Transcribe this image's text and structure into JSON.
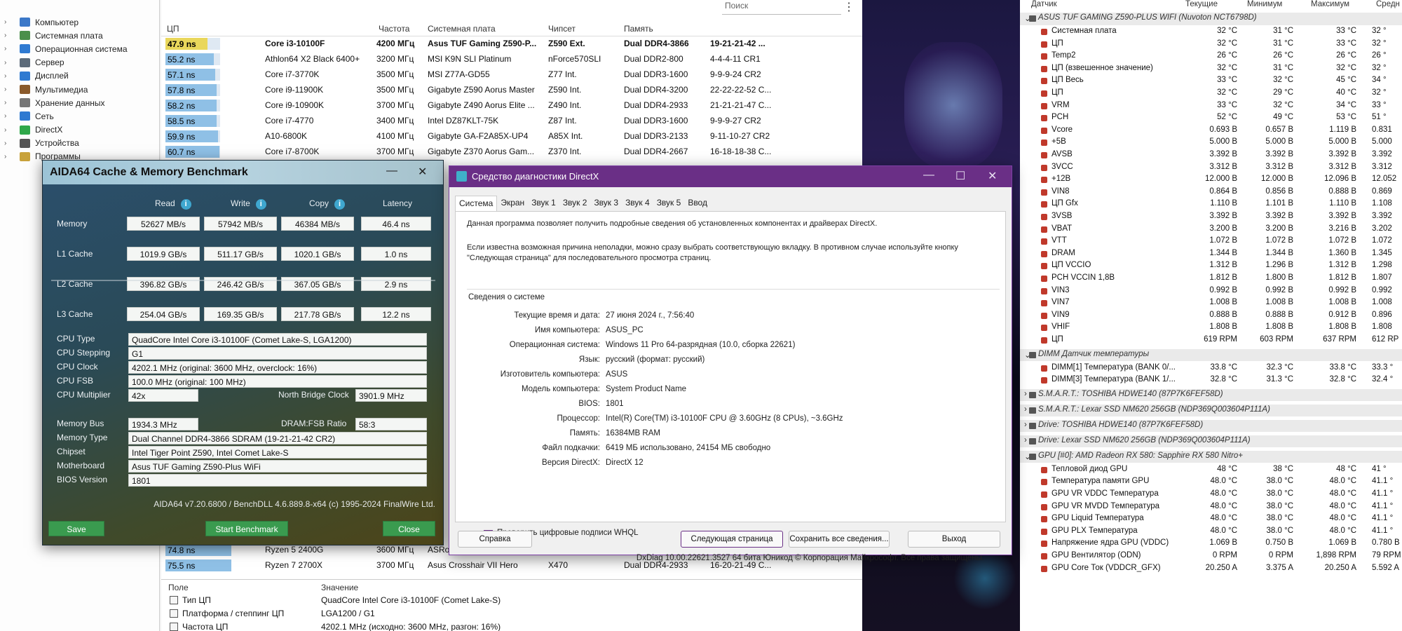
{
  "aida_main": {
    "search_placeholder": "Поиск",
    "sidebar": [
      {
        "label": "Компьютер",
        "color": "#3b78c8"
      },
      {
        "label": "Системная плата",
        "color": "#4a8f4a"
      },
      {
        "label": "Операционная система",
        "color": "#2f7ad1"
      },
      {
        "label": "Сервер",
        "color": "#5c6b7a"
      },
      {
        "label": "Дисплей",
        "color": "#2f7ad1"
      },
      {
        "label": "Мультимедиа",
        "color": "#8a5a2b"
      },
      {
        "label": "Хранение данных",
        "color": "#777777"
      },
      {
        "label": "Сеть",
        "color": "#2f7ad1"
      },
      {
        "label": "DirectX",
        "color": "#2fa84a"
      },
      {
        "label": "Устройства",
        "color": "#555555"
      },
      {
        "label": "Программы",
        "color": "#c8a23b"
      }
    ],
    "columns": [
      "ЦП",
      "Частота",
      "Системная плата",
      "Чипсет",
      "Память",
      ""
    ],
    "rows": [
      {
        "score": "47.9 ns",
        "fill": 0.32,
        "cpu": "Core i3-10100F",
        "freq": "4200 МГц",
        "board": "Asus TUF Gaming Z590-P...",
        "chipset": "Z590 Ext.",
        "memory": "Dual DDR4-3866",
        "timing": "19-21-21-42 ...",
        "highlight": true
      },
      {
        "score": "55.2 ns",
        "fill": 0.37,
        "cpu": "Athlon64 X2 Black 6400+",
        "freq": "3200 МГц",
        "board": "MSI K9N SLI Platinum",
        "chipset": "nForce570SLI",
        "memory": "Dual DDR2-800",
        "timing": "4-4-4-11 CR1",
        "highlight": false
      },
      {
        "score": "57.1 ns",
        "fill": 0.38,
        "cpu": "Core i7-3770K",
        "freq": "3500 МГц",
        "board": "MSI Z77A-GD55",
        "chipset": "Z77 Int.",
        "memory": "Dual DDR3-1600",
        "timing": "9-9-9-24 CR2",
        "highlight": false
      },
      {
        "score": "57.8 ns",
        "fill": 0.39,
        "cpu": "Core i9-11900K",
        "freq": "3500 МГц",
        "board": "Gigabyte Z590 Aorus Master",
        "chipset": "Z590 Int.",
        "memory": "Dual DDR4-3200",
        "timing": "22-22-22-52 C...",
        "highlight": false
      },
      {
        "score": "58.2 ns",
        "fill": 0.39,
        "cpu": "Core i9-10900K",
        "freq": "3700 МГц",
        "board": "Gigabyte Z490 Aorus Elite ...",
        "chipset": "Z490 Int.",
        "memory": "Dual DDR4-2933",
        "timing": "21-21-21-47 C...",
        "highlight": false
      },
      {
        "score": "58.5 ns",
        "fill": 0.39,
        "cpu": "Core i7-4770",
        "freq": "3400 МГц",
        "board": "Intel DZ87KLT-75K",
        "chipset": "Z87 Int.",
        "memory": "Dual DDR3-1600",
        "timing": "9-9-9-27 CR2",
        "highlight": false
      },
      {
        "score": "59.9 ns",
        "fill": 0.4,
        "cpu": "A10-6800K",
        "freq": "4100 МГц",
        "board": "Gigabyte GA-F2A85X-UP4",
        "chipset": "A85X Int.",
        "memory": "Dual DDR3-2133",
        "timing": "9-11-10-27 CR2",
        "highlight": false
      },
      {
        "score": "60.7 ns",
        "fill": 0.41,
        "cpu": "Core i7-8700K",
        "freq": "3700 МГц",
        "board": "Gigabyte Z370 Aorus Gam...",
        "chipset": "Z370 Int.",
        "memory": "Dual DDR4-2667",
        "timing": "16-18-18-38 C...",
        "highlight": false
      }
    ],
    "rows_lower": [
      {
        "score": "74.8 ns",
        "fill": 0.5,
        "cpu": "Ryzen 5 2400G",
        "freq": "3600 МГц",
        "board": "ASRo...",
        "chipset": "",
        "memory": "",
        "timing": ""
      },
      {
        "score": "75.5 ns",
        "fill": 0.5,
        "cpu": "Ryzen 7 2700X",
        "freq": "3700 МГц",
        "board": "Asus Crosshair VII Hero",
        "chipset": "X470",
        "memory": "Dual DDR4-2933",
        "timing": "16-20-21-49 C..."
      }
    ],
    "bottom": {
      "col_field": "Поле",
      "col_value": "Значение",
      "rows": [
        {
          "field": "Тип ЦП",
          "value": "QuadCore Intel Core i3-10100F  (Comet Lake-S)"
        },
        {
          "field": "Платформа / степпинг ЦП",
          "value": "LGA1200 / G1"
        },
        {
          "field": "Частота ЦП",
          "value": "4202.1 MHz  (исходно: 3600 MHz, разгон: 16%)"
        }
      ]
    }
  },
  "bench": {
    "title": "AIDA64 Cache & Memory Benchmark",
    "headers": {
      "read": "Read",
      "write": "Write",
      "copy": "Copy",
      "latency": "Latency"
    },
    "rows": [
      {
        "label": "Memory",
        "read": "52627 MB/s",
        "write": "57942 MB/s",
        "copy": "46384 MB/s",
        "latency": "46.4 ns"
      },
      {
        "label": "L1 Cache",
        "read": "1019.9 GB/s",
        "write": "511.17 GB/s",
        "copy": "1020.1 GB/s",
        "latency": "1.0 ns"
      },
      {
        "label": "L2 Cache",
        "read": "396.82 GB/s",
        "write": "246.42 GB/s",
        "copy": "367.05 GB/s",
        "latency": "2.9 ns"
      },
      {
        "label": "L3 Cache",
        "read": "254.04 GB/s",
        "write": "169.35 GB/s",
        "copy": "217.78 GB/s",
        "latency": "12.2 ns"
      }
    ],
    "cpu": {
      "type_label": "CPU Type",
      "type": "QuadCore Intel Core i3-10100F  (Comet Lake-S, LGA1200)",
      "stepping_label": "CPU Stepping",
      "stepping": "G1",
      "clock_label": "CPU Clock",
      "clock": "4202.1 MHz  (original: 3600 MHz, overclock: 16%)",
      "fsb_label": "CPU FSB",
      "fsb": "100.0 MHz  (original: 100 MHz)",
      "mult_label": "CPU Multiplier",
      "mult": "42x",
      "nb_label": "North Bridge Clock",
      "nb": "3901.9 MHz"
    },
    "mem": {
      "bus_label": "Memory Bus",
      "bus": "1934.3 MHz",
      "ratio_label": "DRAM:FSB Ratio",
      "ratio": "58:3",
      "type_label": "Memory Type",
      "type": "Dual Channel DDR4-3866 SDRAM  (19-21-21-42 CR2)",
      "chipset_label": "Chipset",
      "chipset": "Intel Tiger Point Z590, Intel Comet Lake-S",
      "mb_label": "Motherboard",
      "mb": "Asus TUF Gaming Z590-Plus WiFi",
      "bios_label": "BIOS Version",
      "bios": "1801"
    },
    "footer": "AIDA64 v7.20.6800 / BenchDLL 4.6.889.8-x64  (c) 1995-2024 FinalWire Ltd.",
    "buttons": {
      "save": "Save",
      "start": "Start Benchmark",
      "close": "Close"
    }
  },
  "dx": {
    "title": "Средство диагностики DirectX",
    "tabs": [
      "Система",
      "Экран",
      "Звук 1",
      "Звук 2",
      "Звук 3",
      "Звук 4",
      "Звук 5",
      "Ввод"
    ],
    "intro": "Данная программа позволяет получить подробные сведения об установленных компонентах и драйверах DirectX.",
    "hint": "Если известна возможная причина неполадки, можно сразу выбрать соответствующую вкладку. В противном случае используйте кнопку \"Следующая страница\" для последовательного просмотра страниц.",
    "section": "Сведения о системе",
    "info": [
      {
        "k": "Текущие время и дата:",
        "v": "27 июня 2024 г., 7:56:40"
      },
      {
        "k": "Имя компьютера:",
        "v": "ASUS_PC"
      },
      {
        "k": "Операционная система:",
        "v": "Windows 11 Pro 64-разрядная (10.0, сборка 22621)"
      },
      {
        "k": "Язык:",
        "v": "русский (формат: русский)"
      },
      {
        "k": "Изготовитель компьютера:",
        "v": "ASUS"
      },
      {
        "k": "Модель компьютера:",
        "v": "System Product Name"
      },
      {
        "k": "BIOS:",
        "v": "1801"
      },
      {
        "k": "Процессор:",
        "v": "Intel(R) Core(TM) i3-10100F CPU @ 3.60GHz (8 CPUs), ~3.6GHz"
      },
      {
        "k": "Память:",
        "v": "16384MB RAM"
      },
      {
        "k": "Файл подкачки:",
        "v": "6419 МБ использовано, 24154 МБ свободно"
      },
      {
        "k": "Версия DirectX:",
        "v": "DirectX 12"
      }
    ],
    "whql": "Проверить цифровые подписи WHQL",
    "footer": "DxDiag 10.00.22621.3527 64 бита Юникод © Корпорация Майкрософт. Все права защищены.",
    "buttons": {
      "help": "Справка",
      "next": "Следующая страница",
      "save": "Сохранить все сведения...",
      "exit": "Выход"
    }
  },
  "hw": {
    "headers": {
      "sensor": "Датчик",
      "current": "Текущие",
      "min": "Минимум",
      "max": "Максимум",
      "avg": "Средн"
    },
    "groups": [
      {
        "name": "ASUS TUF GAMING Z590-PLUS WIFI (Nuvoton NCT6798D)",
        "rows": [
          [
            "Системная плата",
            "32 °C",
            "31 °C",
            "33 °C",
            "32 °"
          ],
          [
            "ЦП",
            "32 °C",
            "31 °C",
            "33 °C",
            "32 °"
          ],
          [
            "Temp2",
            "26 °C",
            "26 °C",
            "26 °C",
            "26 °"
          ],
          [
            "ЦП (взвешенное значение)",
            "32 °C",
            "31 °C",
            "32 °C",
            "32 °"
          ],
          [
            "ЦП Весь",
            "33 °C",
            "32 °C",
            "45 °C",
            "34 °"
          ],
          [
            "ЦП",
            "32 °C",
            "29 °C",
            "40 °C",
            "32 °"
          ],
          [
            "VRM",
            "33 °C",
            "32 °C",
            "34 °C",
            "33 °"
          ],
          [
            "PCH",
            "52 °C",
            "49 °C",
            "53 °C",
            "51 °"
          ],
          [
            "Vcore",
            "0.693 В",
            "0.657 В",
            "1.119 В",
            "0.831"
          ],
          [
            "+5В",
            "5.000 В",
            "5.000 В",
            "5.000 В",
            "5.000"
          ],
          [
            "AVSB",
            "3.392 В",
            "3.392 В",
            "3.392 В",
            "3.392"
          ],
          [
            "3VCC",
            "3.312 В",
            "3.312 В",
            "3.312 В",
            "3.312"
          ],
          [
            "+12В",
            "12.000 В",
            "12.000 В",
            "12.096 В",
            "12.052"
          ],
          [
            "VIN8",
            "0.864 В",
            "0.856 В",
            "0.888 В",
            "0.869"
          ],
          [
            "ЦП Gfx",
            "1.110 В",
            "1.101 В",
            "1.110 В",
            "1.108"
          ],
          [
            "3VSB",
            "3.392 В",
            "3.392 В",
            "3.392 В",
            "3.392"
          ],
          [
            "VBAT",
            "3.200 В",
            "3.200 В",
            "3.216 В",
            "3.202"
          ],
          [
            "VTT",
            "1.072 В",
            "1.072 В",
            "1.072 В",
            "1.072"
          ],
          [
            "DRAM",
            "1.344 В",
            "1.344 В",
            "1.360 В",
            "1.345"
          ],
          [
            "ЦП VCCIO",
            "1.312 В",
            "1.296 В",
            "1.312 В",
            "1.298"
          ],
          [
            "PCH VCCIN 1,8В",
            "1.812 В",
            "1.800 В",
            "1.812 В",
            "1.807"
          ],
          [
            "VIN3",
            "0.992 В",
            "0.992 В",
            "0.992 В",
            "0.992"
          ],
          [
            "VIN7",
            "1.008 В",
            "1.008 В",
            "1.008 В",
            "1.008"
          ],
          [
            "VIN9",
            "0.888 В",
            "0.888 В",
            "0.912 В",
            "0.896"
          ],
          [
            "VHIF",
            "1.808 В",
            "1.808 В",
            "1.808 В",
            "1.808"
          ],
          [
            "ЦП",
            "619 RPM",
            "603 RPM",
            "637 RPM",
            "612 RP"
          ]
        ]
      },
      {
        "name": "DIMM Датчик температуры",
        "rows": [
          [
            "DIMM[1] Температура (BANK 0/...",
            "33.8 °C",
            "32.3 °C",
            "33.8 °C",
            "33.3 °"
          ],
          [
            "DIMM[3] Температура (BANK 1/...",
            "32.8 °C",
            "31.3 °C",
            "32.8 °C",
            "32.4 °"
          ]
        ]
      },
      {
        "name": "S.M.A.R.T.: TOSHIBA HDWE140 (87P7K6FEF58D)",
        "rows": []
      },
      {
        "name": "S.M.A.R.T.: Lexar SSD NM620 256GB (NDP369Q003604P111A)",
        "rows": []
      },
      {
        "name": "Drive: TOSHIBA HDWE140 (87P7K6FEF58D)",
        "rows": []
      },
      {
        "name": "Drive: Lexar SSD NM620 256GB (NDP369Q003604P111A)",
        "rows": []
      },
      {
        "name": "GPU [#0]: AMD Radeon RX 580: Sapphire RX 580 Nitro+",
        "rows": [
          [
            "Тепловой диод GPU",
            "48 °C",
            "38 °C",
            "48 °C",
            "41 °"
          ],
          [
            "Температура памяти GPU",
            "48.0 °C",
            "38.0 °C",
            "48.0 °C",
            "41.1 °"
          ],
          [
            "GPU VR VDDC Температура",
            "48.0 °C",
            "38.0 °C",
            "48.0 °C",
            "41.1 °"
          ],
          [
            "GPU VR MVDD Температура",
            "48.0 °C",
            "38.0 °C",
            "48.0 °C",
            "41.1 °"
          ],
          [
            "GPU Liquid Температура",
            "48.0 °C",
            "38.0 °C",
            "48.0 °C",
            "41.1 °"
          ],
          [
            "GPU PLX Температура",
            "48.0 °C",
            "38.0 °C",
            "48.0 °C",
            "41.1 °"
          ],
          [
            "Напряжение ядра GPU (VDDC)",
            "1.069 В",
            "0.750 В",
            "1.069 В",
            "0.780 В"
          ],
          [
            "GPU Вентилятор (ODN)",
            "0 RPM",
            "0 RPM",
            "1,898 RPM",
            "79 RPM"
          ],
          [
            "GPU Core Ток (VDDCR_GFX)",
            "20.250 A",
            "3.375 A",
            "20.250 A",
            "5.592 A"
          ]
        ]
      }
    ]
  }
}
